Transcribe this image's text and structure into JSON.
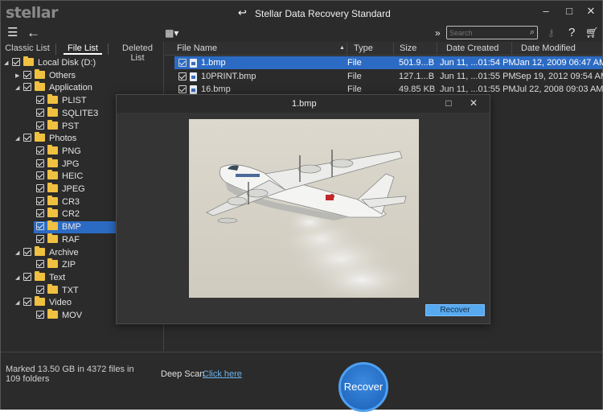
{
  "app": {
    "logo": "stellar",
    "title": "Stellar Data Recovery Standard"
  },
  "toolbar": {
    "search_placeholder": "Search"
  },
  "left_tabs": [
    "Classic List",
    "File List",
    "Deleted List"
  ],
  "tree": [
    {
      "label": "Local Disk (D:)",
      "level": 0,
      "expanded": true,
      "selected": false
    },
    {
      "label": "Others",
      "level": 1,
      "expanded": false,
      "selected": false
    },
    {
      "label": "Application",
      "level": 1,
      "expanded": true,
      "selected": false
    },
    {
      "label": "PLIST",
      "level": 2,
      "selected": false
    },
    {
      "label": "SQLITE3",
      "level": 2,
      "selected": false
    },
    {
      "label": "PST",
      "level": 2,
      "selected": false
    },
    {
      "label": "Photos",
      "level": 1,
      "expanded": true,
      "selected": false
    },
    {
      "label": "PNG",
      "level": 2,
      "selected": false
    },
    {
      "label": "JPG",
      "level": 2,
      "selected": false
    },
    {
      "label": "HEIC",
      "level": 2,
      "selected": false
    },
    {
      "label": "JPEG",
      "level": 2,
      "selected": false
    },
    {
      "label": "CR3",
      "level": 2,
      "selected": false
    },
    {
      "label": "CR2",
      "level": 2,
      "selected": false
    },
    {
      "label": "BMP",
      "level": 2,
      "selected": true
    },
    {
      "label": "RAF",
      "level": 2,
      "selected": false
    },
    {
      "label": "Archive",
      "level": 1,
      "expanded": true,
      "selected": false
    },
    {
      "label": "ZIP",
      "level": 2,
      "selected": false
    },
    {
      "label": "Text",
      "level": 1,
      "expanded": true,
      "selected": false
    },
    {
      "label": "TXT",
      "level": 2,
      "selected": false
    },
    {
      "label": "Video",
      "level": 1,
      "expanded": true,
      "selected": false
    },
    {
      "label": "MOV",
      "level": 2,
      "selected": false
    }
  ],
  "columns": [
    "File Name",
    "Type",
    "Size",
    "Date Created",
    "Date Modified"
  ],
  "files": [
    {
      "name": "1.bmp",
      "type": "File",
      "size": "501.9...B",
      "created": "Jun 11, ...01:54 PM",
      "modified": "Jan 12, 2009 06:47 AM",
      "selected": true
    },
    {
      "name": "10PRINT.bmp",
      "type": "File",
      "size": "127.1...B",
      "created": "Jun 11, ...01:55 PM",
      "modified": "Sep 19, 2012 09:54 AM",
      "selected": false
    },
    {
      "name": "16.bmp",
      "type": "File",
      "size": "49.85 KB",
      "created": "Jun 11, ...01:55 PM",
      "modified": "Jul 22, 2008 09:03 AM",
      "selected": false
    }
  ],
  "status": {
    "marked": "Marked 13.50 GB in 4372 files in 109 folders",
    "deep_scan_label": "Deep Scan",
    "deep_scan_link": "Click here",
    "recover_label": "Recover"
  },
  "preview_dialog": {
    "title": "1.bmp",
    "recover_label": "Recover"
  },
  "colors": {
    "background": "#2b2b2b",
    "selection": "#2c6bc4",
    "accent": "#58aaf0",
    "folder": "#f0c040",
    "link": "#6ab4f0"
  }
}
